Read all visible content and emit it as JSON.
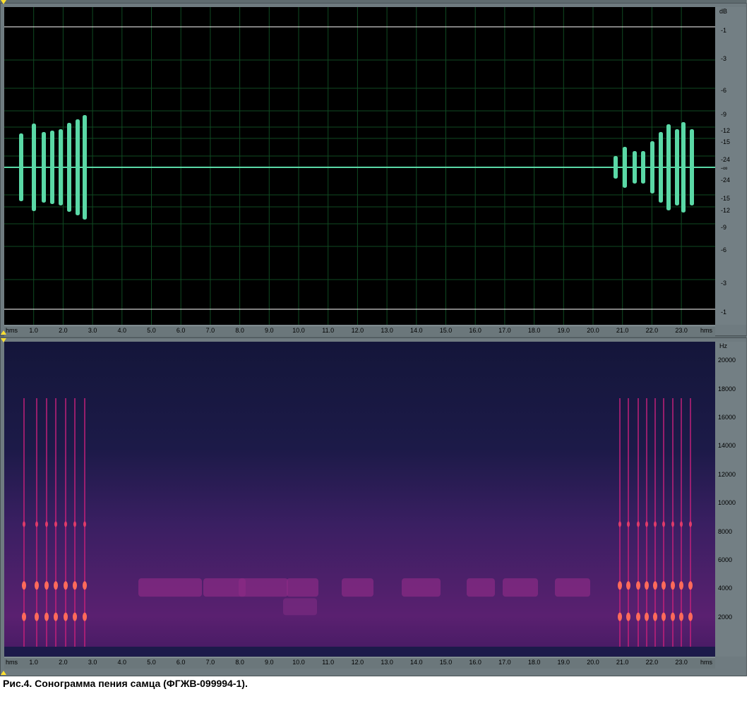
{
  "waveform_panel": {
    "db_unit": "dB",
    "db_labels_top": [
      "-1",
      "-3",
      "-6",
      "-9",
      "-12",
      "-15",
      "-24"
    ],
    "db_center_label": "-∞",
    "db_labels_bottom": [
      "-24",
      "-15",
      "-12",
      "-9",
      "-6",
      "-3",
      "-1"
    ],
    "time_unit_left": "hms",
    "time_unit_right": "hms",
    "time_labels": [
      "1.0",
      "2.0",
      "3.0",
      "4.0",
      "5.0",
      "6.0",
      "7.0",
      "8.0",
      "9.0",
      "10.0",
      "11.0",
      "12.0",
      "13.0",
      "14.0",
      "15.0",
      "16.0",
      "17.0",
      "18.0",
      "19.0",
      "20.0",
      "21.0",
      "22.0",
      "23.0"
    ],
    "colors": {
      "background": "#000000",
      "grid": "#0f4a22",
      "waveform": "#5ad8a6",
      "clip_lines": "#ffffff"
    }
  },
  "spectrogram_panel": {
    "freq_unit": "Hz",
    "freq_labels": [
      "20000",
      "18000",
      "16000",
      "14000",
      "12000",
      "10000",
      "8000",
      "6000",
      "4000",
      "2000"
    ],
    "time_unit_left": "hms",
    "time_unit_right": "hms",
    "time_labels": [
      "1.0",
      "2.0",
      "3.0",
      "4.0",
      "5.0",
      "6.0",
      "7.0",
      "8.0",
      "9.0",
      "10.0",
      "11.0",
      "12.0",
      "13.0",
      "14.0",
      "15.0",
      "16.0",
      "17.0",
      "18.0",
      "19.0",
      "20.0",
      "21.0",
      "22.0",
      "23.0"
    ],
    "colors": {
      "background": "#16183f",
      "noise": "#3a1e63",
      "energy": "#c2207a",
      "hot": "#ff6a5a"
    }
  },
  "caption": "Рис.4. Сонограмма пения самца (ФГЖВ-099994-1)."
}
